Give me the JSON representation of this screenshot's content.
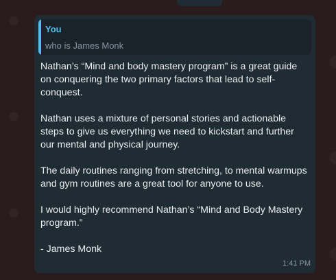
{
  "message": {
    "quote": {
      "author": "You",
      "text": "who is James Monk"
    },
    "paragraphs": [
      "Nathan’s “Mind and body mastery program” is a great guide on conquering the two primary factors that lead to self-conquest.",
      "Nathan uses a mixture of personal stories and actionable steps to give us everything we need to kickstart and further our mental and physical journey.",
      "The daily routines ranging from stretching, to mental warmups and gym routines are a great tool for anyone to use.",
      "I would highly recommend Nathan’s “Mind and Body Mastery program.”",
      "- James Monk"
    ],
    "time": "1:41 PM"
  },
  "colors": {
    "background": "#2a1b1c",
    "bubble": "#202c33",
    "quote_background": "#1a2329",
    "quote_accent": "#53bdeb",
    "text_primary": "#e9edef",
    "text_secondary": "#8696a0"
  }
}
